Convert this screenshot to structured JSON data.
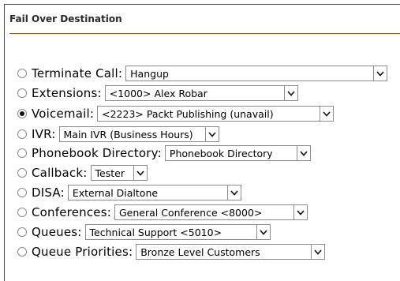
{
  "section": {
    "title": "Fail Over Destination"
  },
  "options": [
    {
      "label": "Terminate Call:",
      "value": "Hangup",
      "checked": false
    },
    {
      "label": "Extensions:",
      "value": "<1000> Alex Robar",
      "checked": false
    },
    {
      "label": "Voicemail:",
      "value": "<2223> Packt Publishing (unavail)",
      "checked": true
    },
    {
      "label": "IVR:",
      "value": "Main IVR (Business Hours)",
      "checked": false
    },
    {
      "label": "Phonebook Directory:",
      "value": "Phonebook Directory",
      "checked": false
    },
    {
      "label": "Callback:",
      "value": "Tester",
      "checked": false
    },
    {
      "label": "DISA:",
      "value": "External Dialtone",
      "checked": false
    },
    {
      "label": "Conferences:",
      "value": "General Conference <8000>",
      "checked": false
    },
    {
      "label": "Queues:",
      "value": "Technical Support <5010>",
      "checked": false
    },
    {
      "label": "Queue Priorities:",
      "value": "Bronze Level Customers",
      "checked": false
    }
  ],
  "icons": {
    "dropdown": "chevron-down-icon",
    "radio": "radio-button"
  }
}
